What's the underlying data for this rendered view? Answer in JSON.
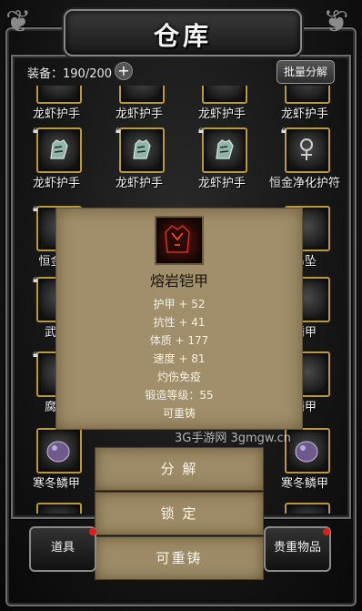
{
  "title": "仓库",
  "capacity": "装备：190/200",
  "plus_symbol": "+",
  "batch_button": "批量分解",
  "items": [
    {
      "label": "龙虾护手",
      "icon": "gauntlet-icon"
    },
    {
      "label": "龙虾护手",
      "icon": "gauntlet-icon"
    },
    {
      "label": "龙虾护手",
      "icon": "gauntlet-icon"
    },
    {
      "label": "龙虾护手",
      "icon": "gauntlet-icon"
    },
    {
      "label": "龙虾护手",
      "icon": "gauntlet-icon"
    },
    {
      "label": "龙虾护手",
      "icon": "gauntlet-icon"
    },
    {
      "label": "龙虾护手",
      "icon": "gauntlet-icon"
    },
    {
      "label": "恒金净化护符",
      "icon": "amulet-icon"
    },
    {
      "label": "恒金净",
      "icon": "amulet-icon"
    },
    {
      "label": "吊坠",
      "icon": "pendant-icon"
    },
    {
      "label": "武斗",
      "icon": "armor-icon"
    },
    {
      "label": "鳞甲",
      "icon": "scale-armor-icon"
    },
    {
      "label": "腐毒",
      "icon": "poison-armor-icon"
    },
    {
      "label": "鳞甲",
      "icon": "scale-armor-icon"
    },
    {
      "label": "寒冬鳞甲",
      "icon": "scale-armor-icon"
    },
    {
      "label": "寒冬鳞甲",
      "icon": "scale-armor-icon"
    }
  ],
  "tooltip": {
    "name": "熔岩铠甲",
    "icon": "lava-armor-icon",
    "stats": [
      "护甲 + 52",
      "抗性 + 41",
      "体质 + 177",
      "速度 + 81",
      "灼伤免疫",
      "锻造等级：55",
      "可重铸"
    ]
  },
  "actions": {
    "decompose": "分 解",
    "lock": "锁 定",
    "recast": "可重铸"
  },
  "bottom": {
    "items_tab": "道具",
    "valuables_tab": "贵重物品"
  },
  "watermark": "3G手游网 3gmgw.cn",
  "colors": {
    "slot_border": "#b89a3c",
    "tooltip_bg": "#a08f6a",
    "badge": "#e01c1c"
  }
}
